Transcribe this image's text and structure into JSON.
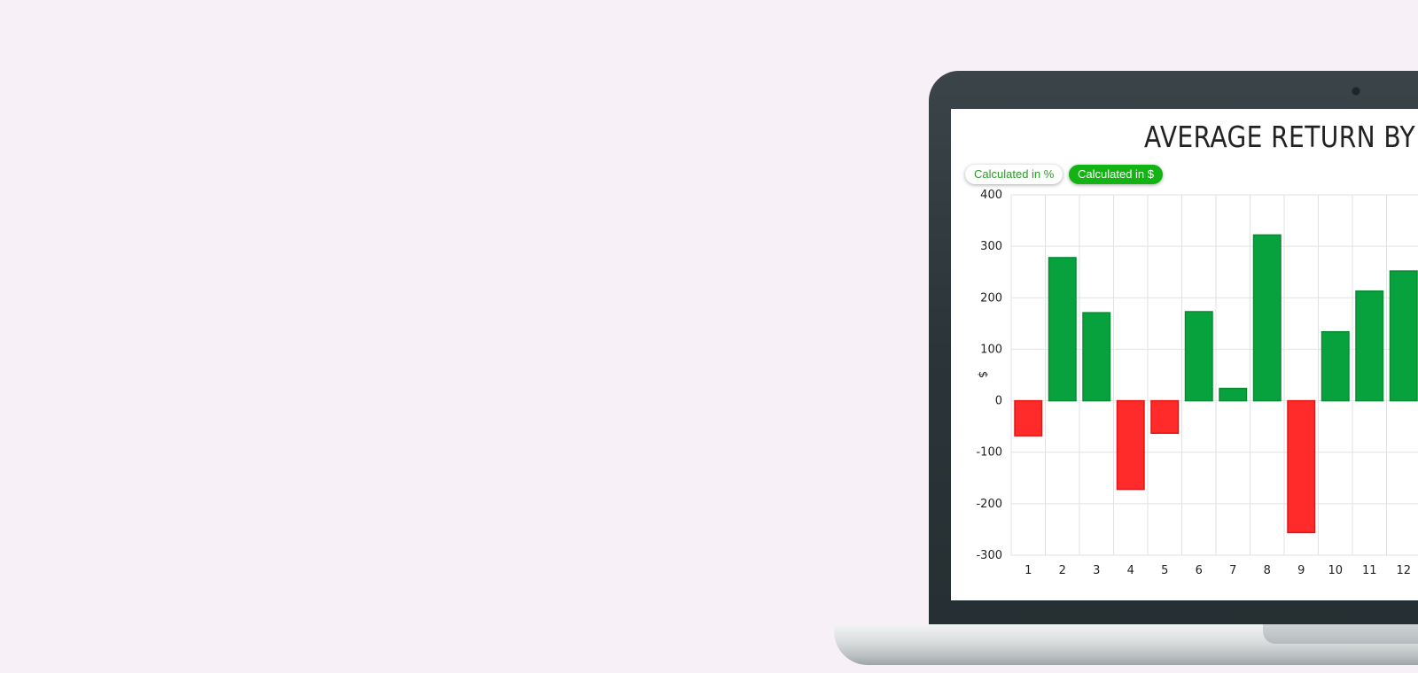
{
  "chart_data": {
    "type": "bar",
    "title": "AVERAGE RETURN BY TRA",
    "ylabel": "$",
    "xlabel": "",
    "categories": [
      "1",
      "2",
      "3",
      "4",
      "5",
      "6",
      "7",
      "8",
      "9",
      "10",
      "11",
      "12"
    ],
    "values": [
      -68,
      278,
      171,
      -172,
      -63,
      173,
      24,
      322,
      -256,
      134,
      213,
      252
    ],
    "ylim": [
      -300,
      400
    ],
    "yticks": [
      400,
      300,
      200,
      100,
      0,
      -100,
      -200,
      -300
    ],
    "grid": true,
    "colors": {
      "positive": "#07a23d",
      "positive_border": "#0a8a35",
      "negative": "#ff2a2a",
      "negative_border": "#e01515"
    }
  },
  "toggles": {
    "percent_label": "Calculated in %",
    "dollar_label": "Calculated in $",
    "active": "dollar"
  }
}
